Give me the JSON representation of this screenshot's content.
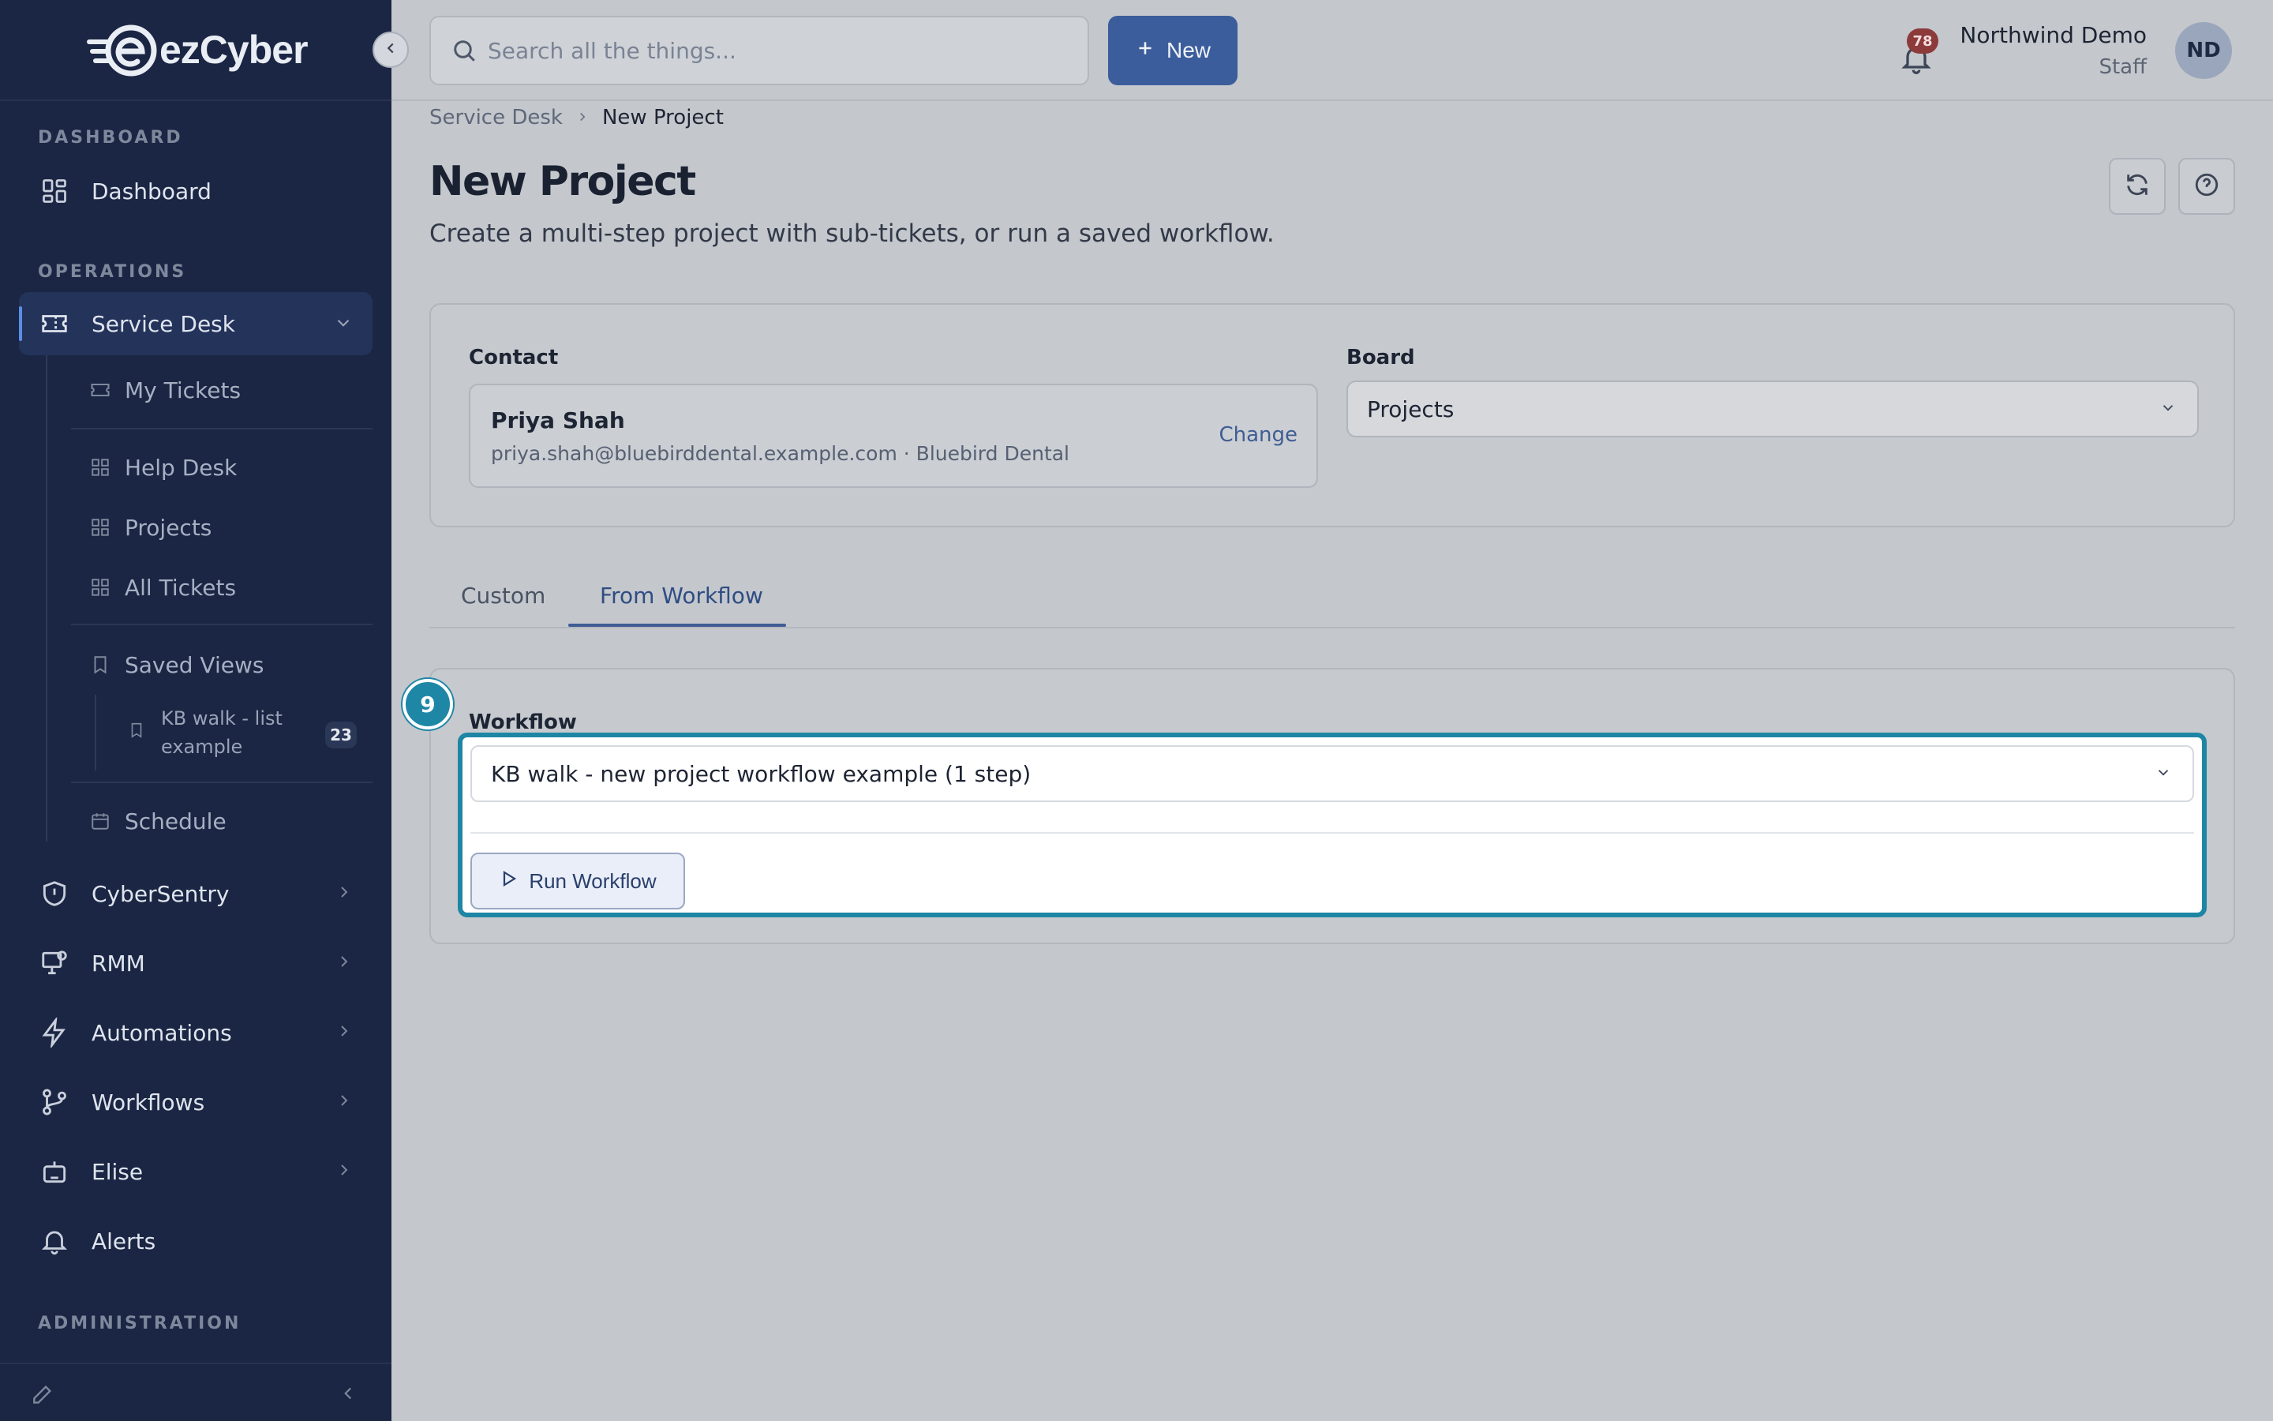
{
  "brand": {
    "name": "ezCyber"
  },
  "sidebar": {
    "sections": {
      "dashboard": "DASHBOARD",
      "operations": "OPERATIONS",
      "administration": "ADMINISTRATION"
    },
    "dashboard_item": "Dashboard",
    "service_desk": {
      "label": "Service Desk",
      "children": {
        "my_tickets": "My Tickets",
        "help_desk": "Help Desk",
        "projects": "Projects",
        "all_tickets": "All Tickets",
        "saved_views": "Saved Views",
        "saved_view_item": {
          "label": "KB walk - list example",
          "count": "23"
        },
        "schedule": "Schedule"
      }
    },
    "modules": {
      "cybersentry": "CyberSentry",
      "rmm": "RMM",
      "automations": "Automations",
      "workflows": "Workflows",
      "elise": "Elise",
      "alerts": "Alerts"
    }
  },
  "topbar": {
    "search_placeholder": "Search all the things...",
    "new_label": "New",
    "notifications_count": "78",
    "user": {
      "name": "Northwind Demo",
      "role": "Staff",
      "initials": "ND"
    }
  },
  "breadcrumb": {
    "parent": "Service Desk",
    "current": "New Project"
  },
  "page": {
    "title": "New Project",
    "subtitle": "Create a multi-step project with sub-tickets, or run a saved workflow."
  },
  "form": {
    "contact_label": "Contact",
    "contact": {
      "name": "Priya Shah",
      "email": "priya.shah@bluebirddental.example.com",
      "company": "Bluebird Dental",
      "separator": "·",
      "change_label": "Change"
    },
    "board_label": "Board",
    "board_value": "Projects"
  },
  "tabs": {
    "custom": "Custom",
    "from_workflow": "From Workflow"
  },
  "workflow": {
    "label": "Workflow",
    "selected": "KB walk - new project workflow example (1 step)",
    "run_label": "Run Workflow",
    "step_number": "9"
  },
  "colors": {
    "sidebar_bg": "#1a2643",
    "accent": "#3c5d9b",
    "highlight": "#1e86a5",
    "notification": "#8c3a3a"
  }
}
